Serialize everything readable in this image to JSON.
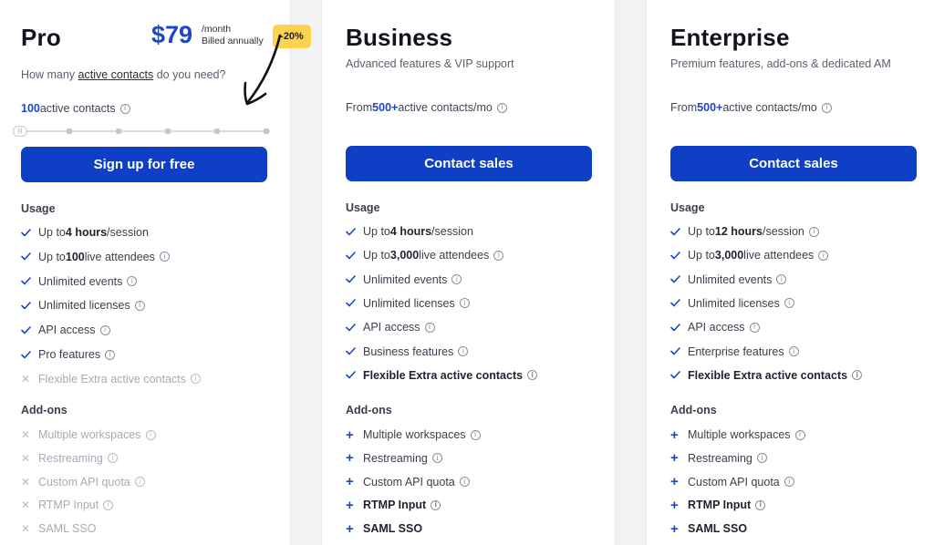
{
  "pro": {
    "title": "Pro",
    "price": "$79",
    "price_period": "/month",
    "price_billing": "Billed annually",
    "discount_badge": "-20%",
    "question_pre": "How many ",
    "question_link": "active contacts",
    "question_post": " do you need?",
    "contacts_value": "100",
    "contacts_label": " active contacts",
    "slider_handle": "|||",
    "cta_label": "Sign up for free",
    "usage_heading": "Usage",
    "addons_heading": "Add-ons",
    "usage": [
      {
        "pre": "Up to ",
        "bold": "4 hours",
        "post": "/session",
        "info": false,
        "state": "check"
      },
      {
        "pre": "Up to ",
        "bold": "100",
        "post": " live attendees",
        "info": true,
        "state": "check"
      },
      {
        "pre": "Unlimited events",
        "bold": "",
        "post": "",
        "info": true,
        "state": "check"
      },
      {
        "pre": "Unlimited licenses",
        "bold": "",
        "post": "",
        "info": true,
        "state": "check"
      },
      {
        "pre": "API access",
        "bold": "",
        "post": "",
        "info": true,
        "state": "check"
      },
      {
        "pre": "Pro features",
        "bold": "",
        "post": "",
        "info": true,
        "state": "check"
      },
      {
        "pre": "Flexible Extra active contacts",
        "bold": "",
        "post": "",
        "info": true,
        "state": "off"
      }
    ],
    "addons": [
      {
        "label": "Multiple workspaces",
        "info": true,
        "state": "off"
      },
      {
        "label": "Restreaming",
        "info": true,
        "state": "off"
      },
      {
        "label": "Custom API quota",
        "info": true,
        "state": "off"
      },
      {
        "label": "RTMP Input",
        "info": true,
        "state": "off"
      },
      {
        "label": "SAML SSO",
        "info": false,
        "state": "off"
      }
    ]
  },
  "business": {
    "title": "Business",
    "subtitle": "Advanced features & VIP support",
    "contacts_pre": "From ",
    "contacts_value": "500+",
    "contacts_post": " active contacts/mo",
    "cta_label": "Contact sales",
    "usage_heading": "Usage",
    "addons_heading": "Add-ons",
    "usage": [
      {
        "pre": "Up to ",
        "bold": "4 hours",
        "post": "/session",
        "info": false,
        "state": "check"
      },
      {
        "pre": "Up to ",
        "bold": "3,000",
        "post": " live attendees",
        "info": true,
        "state": "check"
      },
      {
        "pre": "Unlimited events",
        "bold": "",
        "post": "",
        "info": true,
        "state": "check"
      },
      {
        "pre": "Unlimited licenses",
        "bold": "",
        "post": "",
        "info": true,
        "state": "check"
      },
      {
        "pre": "API access",
        "bold": "",
        "post": "",
        "info": true,
        "state": "check"
      },
      {
        "pre": "Business features",
        "bold": "",
        "post": "",
        "info": true,
        "state": "check"
      },
      {
        "pre": "Flexible Extra active contacts",
        "bold": "",
        "post": "",
        "info": true,
        "state": "strong"
      }
    ],
    "addons": [
      {
        "label": "Multiple workspaces",
        "info": true,
        "state": "plus"
      },
      {
        "label": "Restreaming",
        "info": true,
        "state": "plus"
      },
      {
        "label": "Custom API quota",
        "info": true,
        "state": "plus"
      },
      {
        "label": "RTMP Input",
        "info": true,
        "state": "plus-strong"
      },
      {
        "label": "SAML SSO",
        "info": false,
        "state": "plus-strong"
      }
    ]
  },
  "enterprise": {
    "title": "Enterprise",
    "subtitle": "Premium features, add-ons & dedicated AM",
    "contacts_pre": "From ",
    "contacts_value": "500+",
    "contacts_post": " active contacts/mo",
    "cta_label": "Contact sales",
    "usage_heading": "Usage",
    "addons_heading": "Add-ons",
    "usage": [
      {
        "pre": "Up to ",
        "bold": "12 hours",
        "post": "/session",
        "info": true,
        "state": "check"
      },
      {
        "pre": "Up to ",
        "bold": "3,000",
        "post": " live attendees",
        "info": true,
        "state": "check"
      },
      {
        "pre": "Unlimited events",
        "bold": "",
        "post": "",
        "info": true,
        "state": "check"
      },
      {
        "pre": "Unlimited licenses",
        "bold": "",
        "post": "",
        "info": true,
        "state": "check"
      },
      {
        "pre": "API access",
        "bold": "",
        "post": "",
        "info": true,
        "state": "check"
      },
      {
        "pre": "Enterprise features",
        "bold": "",
        "post": "",
        "info": true,
        "state": "check"
      },
      {
        "pre": "Flexible Extra active contacts",
        "bold": "",
        "post": "",
        "info": true,
        "state": "strong"
      }
    ],
    "addons": [
      {
        "label": "Multiple workspaces",
        "info": true,
        "state": "plus"
      },
      {
        "label": "Restreaming",
        "info": true,
        "state": "plus"
      },
      {
        "label": "Custom API quota",
        "info": true,
        "state": "plus"
      },
      {
        "label": "RTMP Input",
        "info": true,
        "state": "plus-strong"
      },
      {
        "label": "SAML SSO",
        "info": false,
        "state": "plus-strong"
      }
    ]
  },
  "info_glyph": "i",
  "icons": {
    "check": "check-icon",
    "cross": "cross-icon",
    "plus": "plus-icon",
    "info": "info-icon",
    "arrow": "hand-drawn-arrow-icon"
  },
  "colors": {
    "accent": "#0f3fc4",
    "accent_text": "#1a46c8",
    "badge": "#fcd34d",
    "muted": "#a6abb6"
  }
}
